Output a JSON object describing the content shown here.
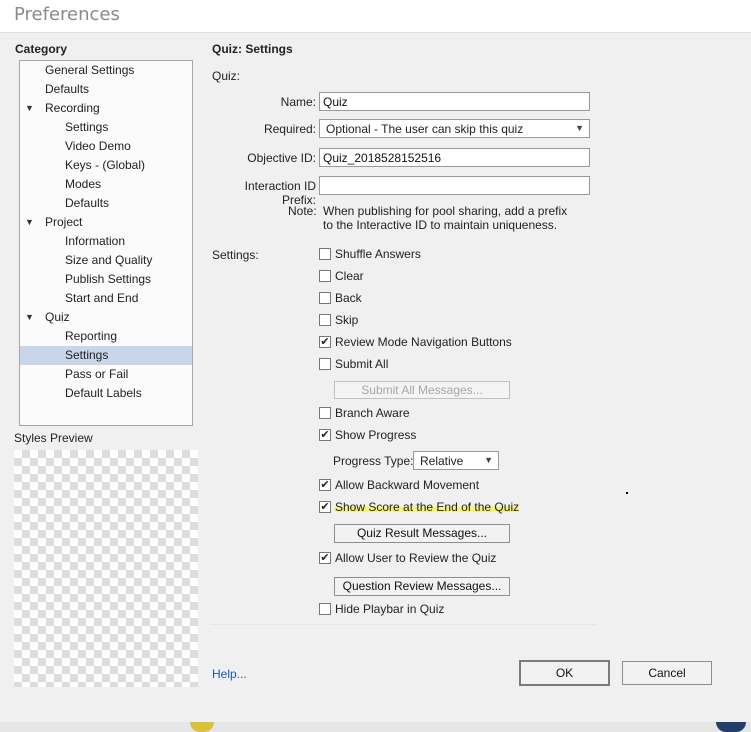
{
  "window": {
    "title": "Preferences"
  },
  "category": {
    "heading": "Category",
    "items": [
      {
        "label": "General Settings",
        "level": 0,
        "expandable": false
      },
      {
        "label": "Defaults",
        "level": 0,
        "expandable": false
      },
      {
        "label": "Recording",
        "level": 0,
        "expandable": true
      },
      {
        "label": "Settings",
        "level": 1,
        "expandable": false
      },
      {
        "label": "Video Demo",
        "level": 1,
        "expandable": false
      },
      {
        "label": "Keys - (Global)",
        "level": 1,
        "expandable": false
      },
      {
        "label": "Modes",
        "level": 1,
        "expandable": false
      },
      {
        "label": "Defaults",
        "level": 1,
        "expandable": false
      },
      {
        "label": "Project",
        "level": 0,
        "expandable": true
      },
      {
        "label": "Information",
        "level": 1,
        "expandable": false
      },
      {
        "label": "Size and Quality",
        "level": 1,
        "expandable": false
      },
      {
        "label": "Publish Settings",
        "level": 1,
        "expandable": false
      },
      {
        "label": "Start and End",
        "level": 1,
        "expandable": false
      },
      {
        "label": "Quiz",
        "level": 0,
        "expandable": true
      },
      {
        "label": "Reporting",
        "level": 1,
        "expandable": false
      },
      {
        "label": "Settings",
        "level": 1,
        "expandable": false,
        "selected": true
      },
      {
        "label": "Pass or Fail",
        "level": 1,
        "expandable": false
      },
      {
        "label": "Default Labels",
        "level": 1,
        "expandable": false
      }
    ],
    "expand_icon": "triangle-down-icon"
  },
  "styles_preview": {
    "label": "Styles Preview"
  },
  "panel": {
    "heading": "Quiz: Settings",
    "quiz_label": "Quiz:",
    "name": {
      "label": "Name:",
      "value": "Quiz"
    },
    "required": {
      "label": "Required:",
      "value": "Optional - The user can skip this quiz"
    },
    "objective_id": {
      "label": "Objective ID:",
      "value": "Quiz_2018528152516"
    },
    "interaction_prefix": {
      "label": "Interaction ID Prefix:",
      "value": ""
    },
    "note": {
      "label": "Note:",
      "line1": "When publishing for pool sharing, add a prefix",
      "line2": "to the Interactive ID to maintain uniqueness."
    },
    "settings_label": "Settings:",
    "checkboxes": {
      "shuffle_answers": {
        "label": "Shuffle Answers",
        "checked": false
      },
      "clear": {
        "label": "Clear",
        "checked": false
      },
      "back": {
        "label": "Back",
        "checked": false
      },
      "skip": {
        "label": "Skip",
        "checked": false
      },
      "review_mode_nav": {
        "label": "Review Mode Navigation Buttons",
        "checked": true
      },
      "submit_all": {
        "label": "Submit All",
        "checked": false
      },
      "branch_aware": {
        "label": "Branch Aware",
        "checked": false
      },
      "show_progress": {
        "label": "Show Progress",
        "checked": true
      },
      "allow_backward": {
        "label": "Allow Backward Movement",
        "checked": true
      },
      "show_score": {
        "label": "Show Score at the End of the Quiz",
        "checked": true,
        "highlight_color": "#f3f37a"
      },
      "allow_review": {
        "label": "Allow User to Review the Quiz",
        "checked": true
      },
      "hide_playbar": {
        "label": "Hide Playbar in Quiz",
        "checked": false
      }
    },
    "submit_all_messages_button": "Submit All Messages...",
    "progress_type": {
      "label": "Progress Type:",
      "value": "Relative"
    },
    "quiz_result_messages_button": "Quiz Result Messages...",
    "question_review_messages_button": "Question Review Messages..."
  },
  "footer": {
    "help": "Help...",
    "ok": "OK",
    "cancel": "Cancel"
  },
  "colors": {
    "selection": "#c9d6ea",
    "link": "#1a57b4",
    "dialog_bg": "#f0f0f0"
  }
}
